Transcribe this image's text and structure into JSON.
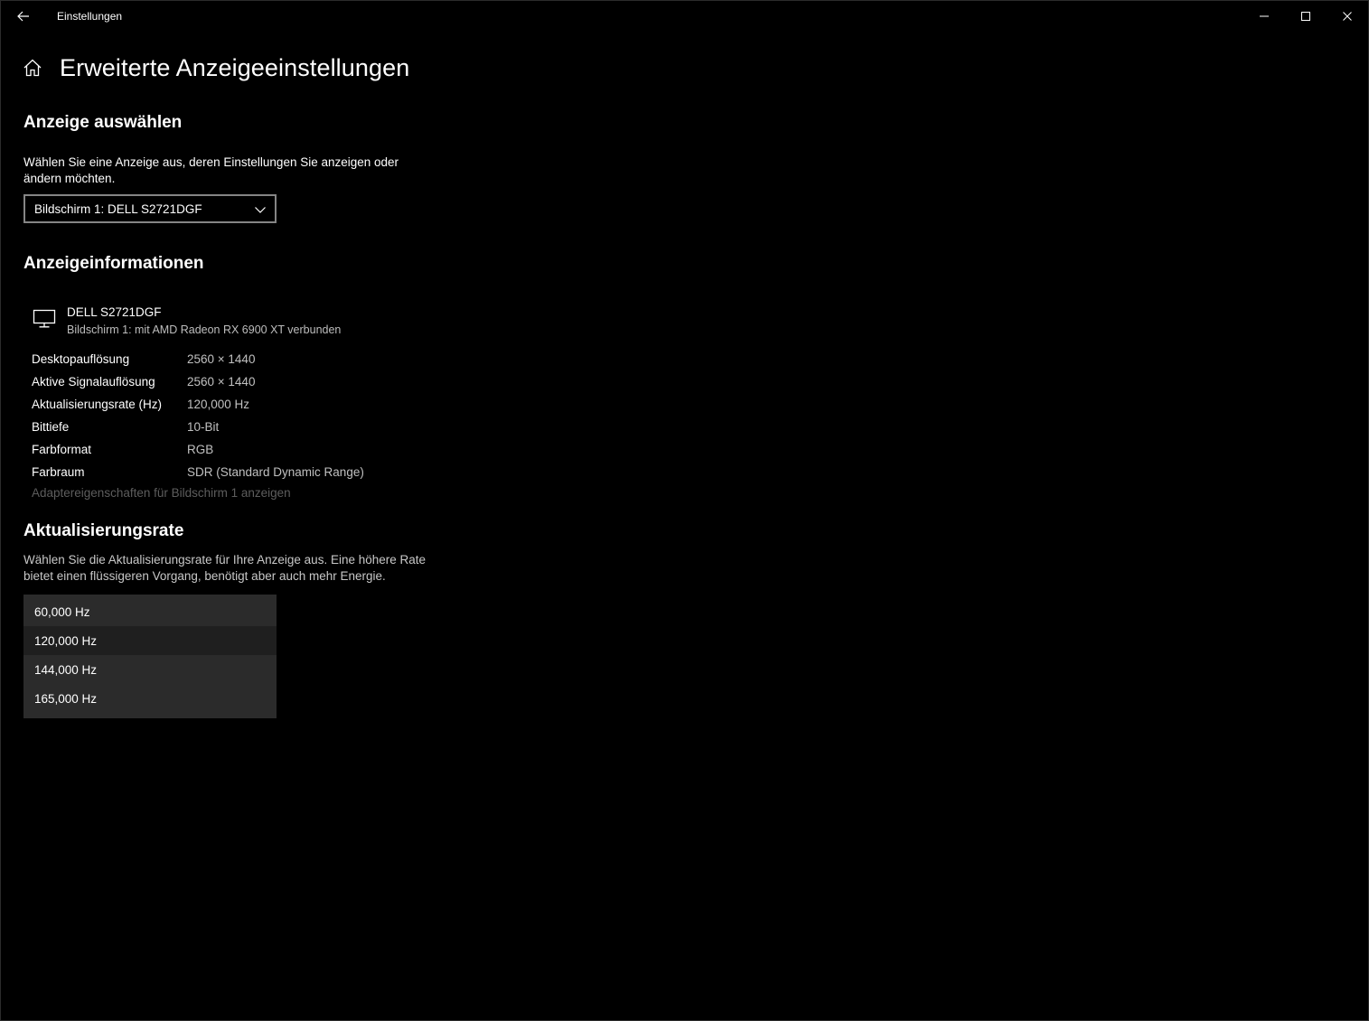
{
  "window": {
    "app_title": "Einstellungen"
  },
  "header": {
    "title": "Erweiterte Anzeigeeinstellungen"
  },
  "select_display": {
    "heading": "Anzeige auswählen",
    "description": "Wählen Sie eine Anzeige aus, deren Einstellungen Sie anzeigen oder ändern möchten.",
    "selected": "Bildschirm 1: DELL S2721DGF"
  },
  "display_info": {
    "heading": "Anzeigeinformationen",
    "monitor_name": "DELL S2721DGF",
    "monitor_sub": "Bildschirm 1: mit AMD Radeon RX 6900 XT verbunden",
    "rows": [
      {
        "label": "Desktopauflösung",
        "value": "2560 × 1440"
      },
      {
        "label": "Aktive Signalauflösung",
        "value": "2560 × 1440"
      },
      {
        "label": "Aktualisierungsrate (Hz)",
        "value": "120,000 Hz"
      },
      {
        "label": "Bittiefe",
        "value": "10-Bit"
      },
      {
        "label": "Farbformat",
        "value": "RGB"
      },
      {
        "label": "Farbraum",
        "value": "SDR (Standard Dynamic Range)"
      }
    ],
    "adapter_link": "Adaptereigenschaften für Bildschirm 1 anzeigen"
  },
  "refresh_rate": {
    "heading": "Aktualisierungsrate",
    "description": "Wählen Sie die Aktualisierungsrate für Ihre Anzeige aus. Eine höhere Rate bietet einen flüssigeren Vorgang, benötigt aber auch mehr Energie.",
    "options": [
      "60,000 Hz",
      "120,000 Hz",
      "144,000 Hz",
      "165,000 Hz"
    ],
    "selected_index": 1
  },
  "icons": {
    "back": "back-arrow-icon",
    "home": "home-icon",
    "monitor": "monitor-icon",
    "minimize": "minimize-icon",
    "maximize": "maximize-icon",
    "close": "close-icon",
    "dropdown": "chevron-down-icon"
  },
  "colors": {
    "background": "#000000",
    "dropdown_panel": "#2b2b2b",
    "selected_option": "#1f1f1f",
    "disabled_link": "#5d5d5d"
  }
}
